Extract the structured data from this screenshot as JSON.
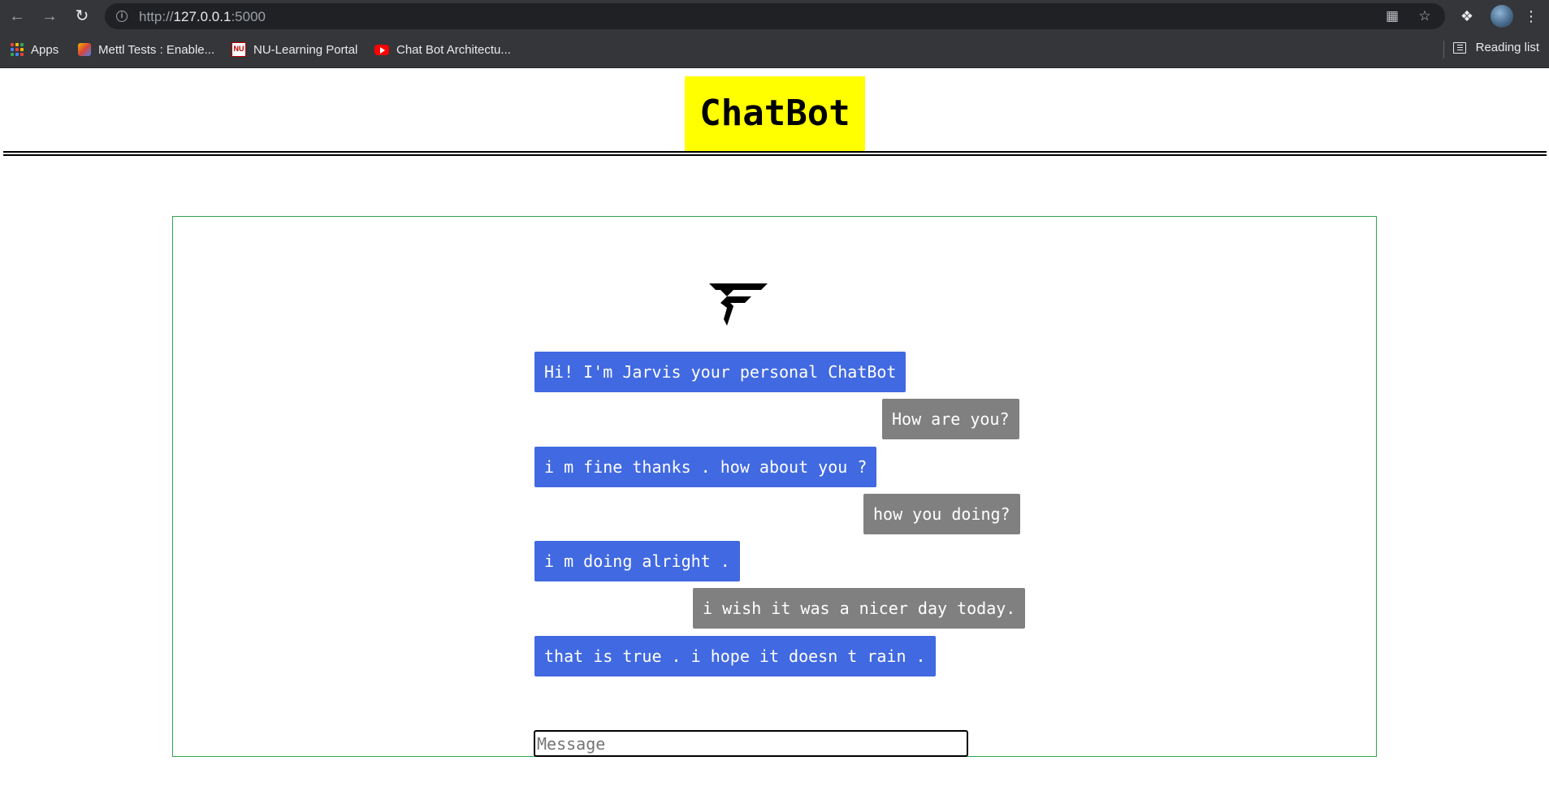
{
  "browser": {
    "url_scheme": "http://",
    "url_host": "127.0.0.1",
    "url_port": ":5000",
    "bookmarks": [
      {
        "label": "Apps",
        "icon": "apps-grid-icon"
      },
      {
        "label": "Mettl Tests : Enable...",
        "icon": "mettl-icon"
      },
      {
        "label": "NU-Learning Portal",
        "icon": "nu-icon"
      },
      {
        "label": "Chat Bot Architectu...",
        "icon": "youtube-icon"
      }
    ],
    "reading_list_label": "Reading list"
  },
  "page": {
    "title": "ChatBot"
  },
  "chat": {
    "messages": [
      {
        "sender": "bot",
        "text": "Hi! I'm Jarvis your personal ChatBot"
      },
      {
        "sender": "user",
        "text": "How are you?"
      },
      {
        "sender": "bot",
        "text": "i m fine thanks . how about you ?"
      },
      {
        "sender": "user",
        "text": "how you doing?"
      },
      {
        "sender": "bot",
        "text": "i m doing alright ."
      },
      {
        "sender": "user",
        "text": "i wish it was a nicer day today."
      },
      {
        "sender": "bot",
        "text": "that is true . i hope it doesn t rain ."
      }
    ],
    "input_placeholder": "Message",
    "input_value": ""
  },
  "colors": {
    "title_background": "#ffff00",
    "bot_bubble": "#4169e1",
    "user_bubble": "#808080",
    "frame_border": "#2ea44f"
  }
}
